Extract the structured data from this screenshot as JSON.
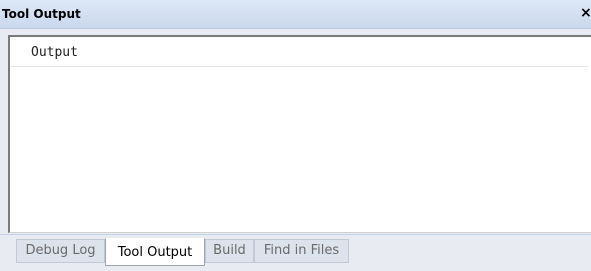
{
  "window": {
    "title": "Tool Output",
    "close_glyph": "×"
  },
  "output": {
    "header": "Output",
    "lines": []
  },
  "tabs": [
    {
      "label": "Debug Log",
      "active": false
    },
    {
      "label": "Tool Output",
      "active": true
    },
    {
      "label": "Build",
      "active": false
    },
    {
      "label": "Find in Files",
      "active": false
    }
  ],
  "colors": {
    "titlebar": "#cbd9ee",
    "panel_background": "#e8ecf2",
    "active_tab": "#ffffff",
    "inactive_tab": "#dde3ec"
  }
}
